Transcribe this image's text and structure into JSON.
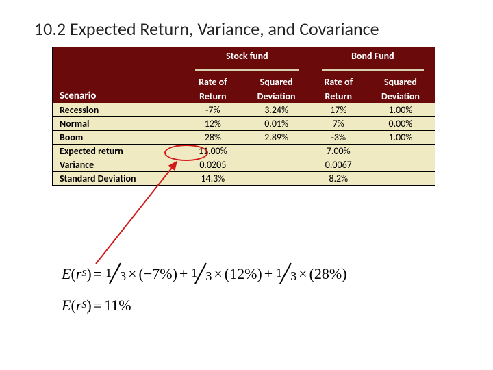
{
  "title": "10.2 Expected Return, Variance, and Covariance",
  "table": {
    "header": {
      "scenario": "Scenario",
      "stock_group": "Stock fund",
      "bond_group": "Bond Fund",
      "rate_top": "Rate of",
      "rate_bot": "Return",
      "sqdev_top": "Squared",
      "sqdev_bot": "Deviation"
    },
    "rows": [
      {
        "label": "Recession",
        "stock_rate": "-7%",
        "stock_sqdev": "3.24%",
        "bond_rate": "17%",
        "bond_sqdev": "1.00%"
      },
      {
        "label": "Normal",
        "stock_rate": "12%",
        "stock_sqdev": "0.01%",
        "bond_rate": "7%",
        "bond_sqdev": "0.00%"
      },
      {
        "label": "Boom",
        "stock_rate": "28%",
        "stock_sqdev": "2.89%",
        "bond_rate": "-3%",
        "bond_sqdev": "1.00%"
      },
      {
        "label": "Expected return",
        "stock_rate": "11.00%",
        "stock_sqdev": "",
        "bond_rate": "7.00%",
        "bond_sqdev": ""
      },
      {
        "label": "Variance",
        "stock_rate": "0.0205",
        "stock_sqdev": "",
        "bond_rate": "0.0067",
        "bond_sqdev": ""
      },
      {
        "label": "Standard Deviation",
        "stock_rate": "14.3%",
        "stock_sqdev": "",
        "bond_rate": "8.2%",
        "bond_sqdev": ""
      }
    ]
  },
  "formula": {
    "lhs_symbol": "E",
    "lhs_inner": "r",
    "lhs_sub": "S",
    "frac_num": "1",
    "frac_den": "3",
    "term1": "(−7%)",
    "term2": "(12%)",
    "term3": "(28%)",
    "result": "11%"
  },
  "chart_data": {
    "type": "table",
    "title": "Fund returns by scenario",
    "columns": [
      "Scenario",
      "Stock Rate of Return",
      "Stock Squared Deviation",
      "Bond Rate of Return",
      "Bond Squared Deviation"
    ],
    "rows": [
      [
        "Recession",
        -0.07,
        0.0324,
        0.17,
        0.01
      ],
      [
        "Normal",
        0.12,
        0.0001,
        0.07,
        0.0
      ],
      [
        "Boom",
        0.28,
        0.0289,
        -0.03,
        0.01
      ]
    ],
    "summary": {
      "expected_return": {
        "stock": 0.11,
        "bond": 0.07
      },
      "variance": {
        "stock": 0.0205,
        "bond": 0.0067
      },
      "standard_deviation": {
        "stock": 0.143,
        "bond": 0.082
      }
    }
  }
}
